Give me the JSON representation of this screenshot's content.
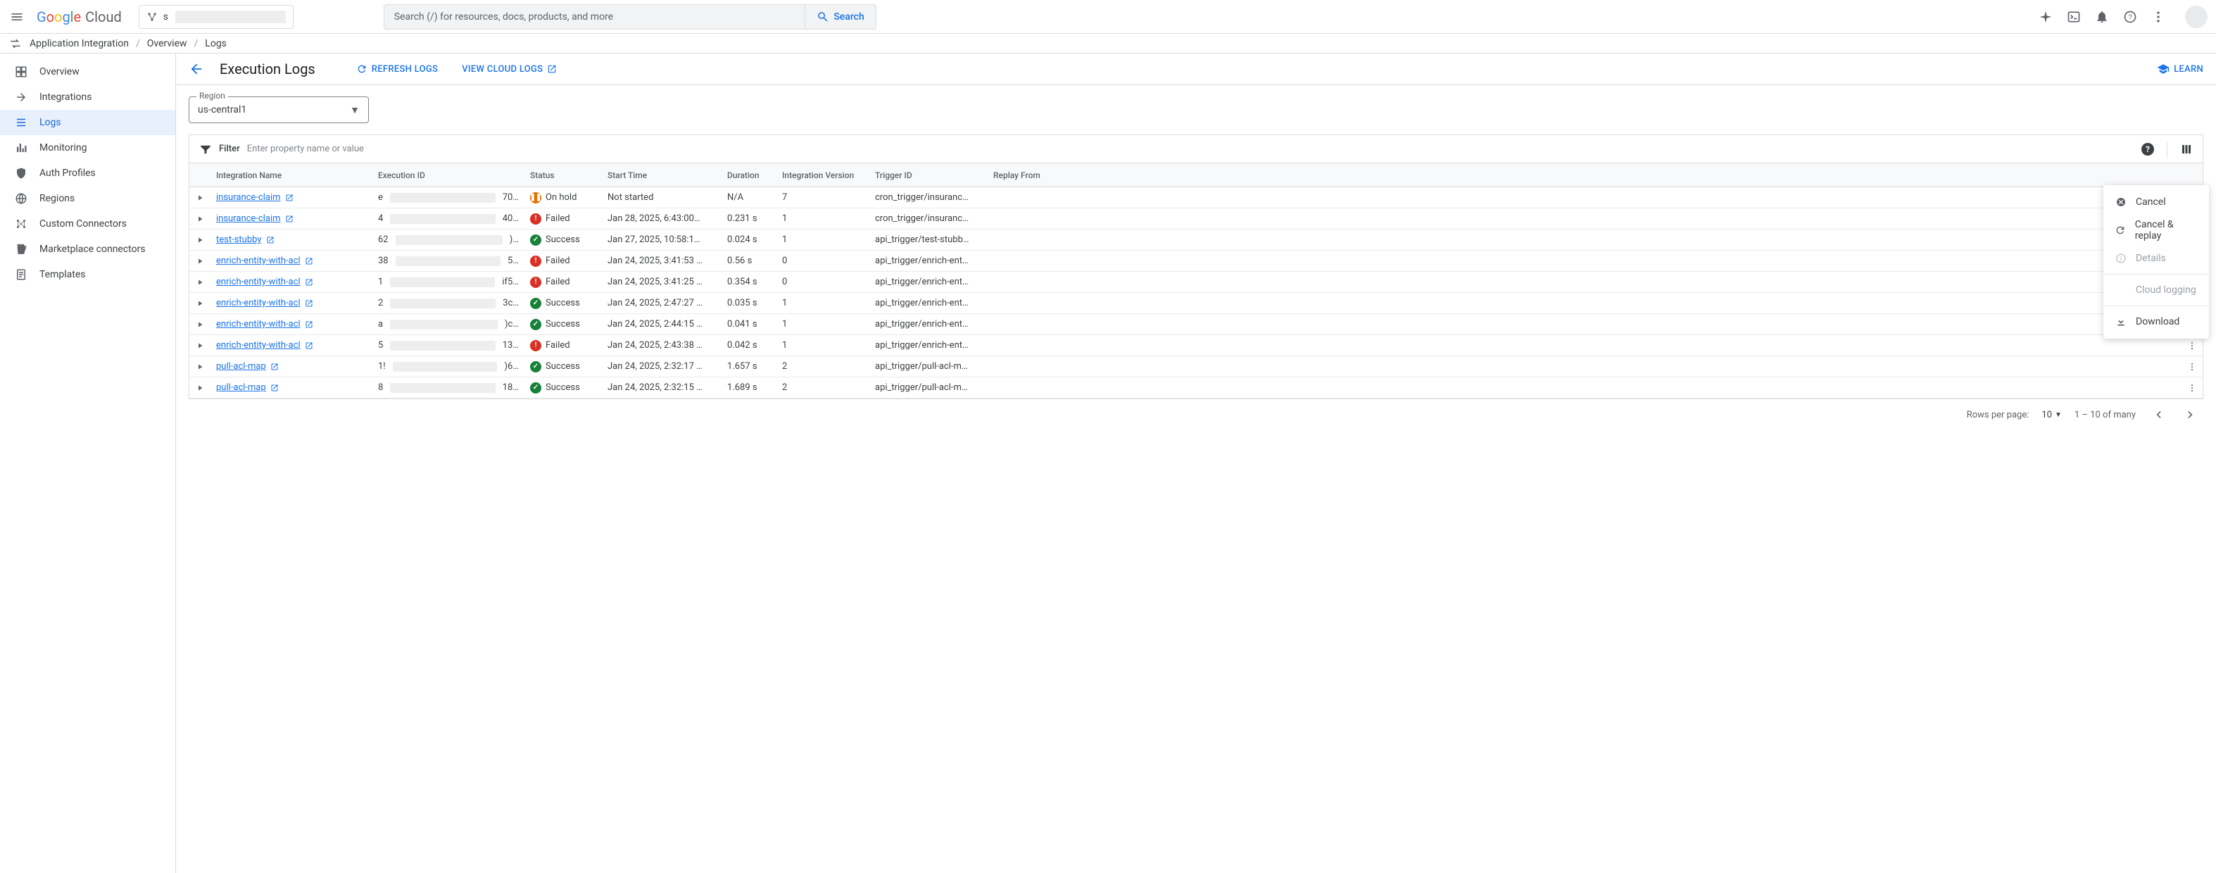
{
  "header": {
    "logo_cloud": "Cloud",
    "project_prefix": "s",
    "search_placeholder": "Search (/) for resources, docs, products, and more",
    "search_button": "Search"
  },
  "breadcrumb": {
    "items": [
      "Application Integration",
      "Overview",
      "Logs"
    ]
  },
  "sidebar": {
    "items": [
      {
        "label": "Overview",
        "icon": "overview"
      },
      {
        "label": "Integrations",
        "icon": "integrations"
      },
      {
        "label": "Logs",
        "icon": "logs",
        "active": true
      },
      {
        "label": "Monitoring",
        "icon": "monitoring"
      },
      {
        "label": "Auth Profiles",
        "icon": "auth"
      },
      {
        "label": "Regions",
        "icon": "regions"
      },
      {
        "label": "Custom Connectors",
        "icon": "connectors"
      },
      {
        "label": "Marketplace connectors",
        "icon": "marketplace"
      },
      {
        "label": "Templates",
        "icon": "templates"
      }
    ]
  },
  "toolbar": {
    "page_title": "Execution Logs",
    "refresh": "REFRESH LOGS",
    "view_cloud": "VIEW CLOUD LOGS",
    "learn": "LEARN"
  },
  "region": {
    "label": "Region",
    "value": "us-central1"
  },
  "filter": {
    "label": "Filter",
    "placeholder": "Enter property name or value"
  },
  "columns": [
    "Integration Name",
    "Execution ID",
    "Status",
    "Start Time",
    "Duration",
    "Integration Version",
    "Trigger ID",
    "Replay From"
  ],
  "rows": [
    {
      "name": "insurance-claim",
      "exec_pre": "e",
      "exec_suf": "70…",
      "status": "On hold",
      "status_type": "hold",
      "start": "Not started",
      "dur": "N/A",
      "ver": "7",
      "trig": "cron_trigger/insuranc…"
    },
    {
      "name": "insurance-claim",
      "exec_pre": "4",
      "exec_suf": "40…",
      "status": "Failed",
      "status_type": "failed",
      "start": "Jan 28, 2025, 6:43:00…",
      "dur": "0.231 s",
      "ver": "1",
      "trig": "cron_trigger/insuranc…"
    },
    {
      "name": "test-stubby",
      "exec_pre": "62",
      "exec_suf": ")…",
      "status": "Success",
      "status_type": "success",
      "start": "Jan 27, 2025, 10:58:1…",
      "dur": "0.024 s",
      "ver": "1",
      "trig": "api_trigger/test-stubb…"
    },
    {
      "name": "enrich-entity-with-acl",
      "exec_pre": "38",
      "exec_suf": "5…",
      "status": "Failed",
      "status_type": "failed",
      "start": "Jan 24, 2025, 3:41:53 …",
      "dur": "0.56 s",
      "ver": "0",
      "trig": "api_trigger/enrich-ent…"
    },
    {
      "name": "enrich-entity-with-acl",
      "exec_pre": "1",
      "exec_suf": "if5…",
      "status": "Failed",
      "status_type": "failed",
      "start": "Jan 24, 2025, 3:41:25 …",
      "dur": "0.354 s",
      "ver": "0",
      "trig": "api_trigger/enrich-ent…"
    },
    {
      "name": "enrich-entity-with-acl",
      "exec_pre": "2",
      "exec_suf": "3c…",
      "status": "Success",
      "status_type": "success",
      "start": "Jan 24, 2025, 2:47:27 …",
      "dur": "0.035 s",
      "ver": "1",
      "trig": "api_trigger/enrich-ent…"
    },
    {
      "name": "enrich-entity-with-acl",
      "exec_pre": "a",
      "exec_suf": ")c…",
      "status": "Success",
      "status_type": "success",
      "start": "Jan 24, 2025, 2:44:15 …",
      "dur": "0.041 s",
      "ver": "1",
      "trig": "api_trigger/enrich-ent…"
    },
    {
      "name": "enrich-entity-with-acl",
      "exec_pre": "5",
      "exec_suf": "13…",
      "status": "Failed",
      "status_type": "failed",
      "start": "Jan 24, 2025, 2:43:38 …",
      "dur": "0.042 s",
      "ver": "1",
      "trig": "api_trigger/enrich-ent…"
    },
    {
      "name": "pull-acl-map",
      "exec_pre": "1!",
      "exec_suf": ")6…",
      "status": "Success",
      "status_type": "success",
      "start": "Jan 24, 2025, 2:32:17 …",
      "dur": "1.657 s",
      "ver": "2",
      "trig": "api_trigger/pull-acl-m…"
    },
    {
      "name": "pull-acl-map",
      "exec_pre": "8",
      "exec_suf": "18…",
      "status": "Success",
      "status_type": "success",
      "start": "Jan 24, 2025, 2:32:15 …",
      "dur": "1.689 s",
      "ver": "2",
      "trig": "api_trigger/pull-acl-m…"
    }
  ],
  "pager": {
    "rows_per_page": "Rows per page:",
    "value": "10",
    "range": "1 – 10 of many"
  },
  "context_menu": {
    "items": [
      {
        "label": "Cancel",
        "icon": "cancel"
      },
      {
        "label": "Cancel & replay",
        "icon": "replay"
      },
      {
        "label": "Details",
        "icon": "info",
        "disabled": true
      },
      {
        "divider": true
      },
      {
        "label": "Cloud logging",
        "disabled": true
      },
      {
        "divider": true
      },
      {
        "label": "Download",
        "icon": "download"
      }
    ]
  }
}
